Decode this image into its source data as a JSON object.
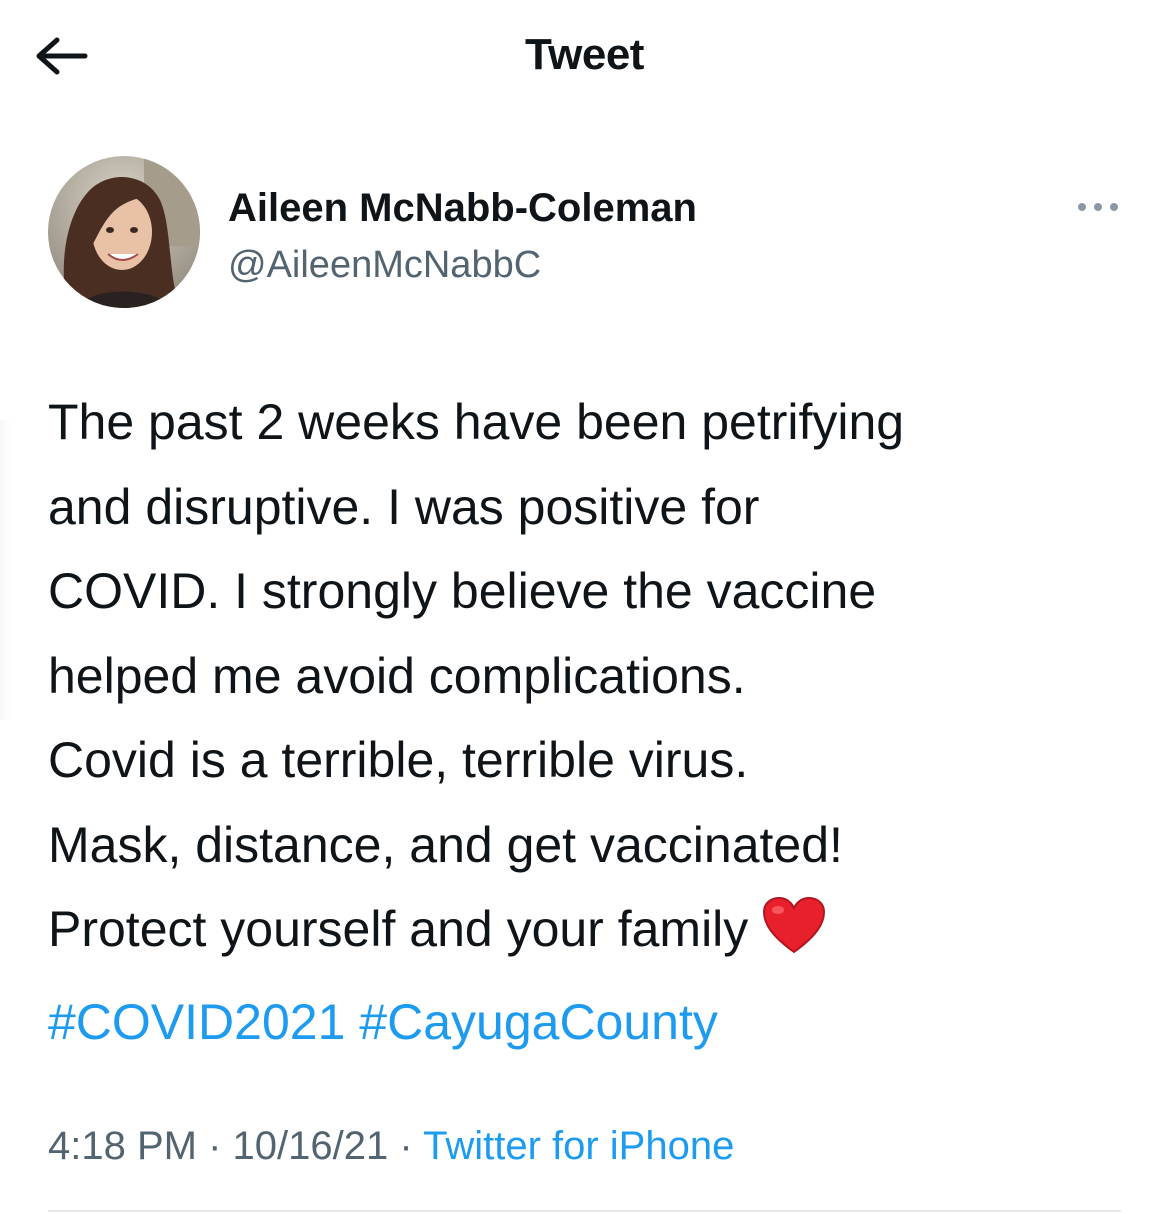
{
  "header": {
    "title": "Tweet",
    "back_icon": "arrow-left-icon"
  },
  "author": {
    "name": "Aileen McNabb-Coleman",
    "handle": "@AileenMcNabbC",
    "more_icon": "more-horizontal-icon"
  },
  "tweet": {
    "lines": [
      "The past 2 weeks have been petrifying",
      "and disruptive. I was positive for",
      "COVID. I strongly believe the vaccine",
      "helped me avoid complications.",
      "Covid is a terrible, terrible virus.",
      "Mask, distance, and get vaccinated!",
      "Protect yourself and your family"
    ],
    "emoji": "red-heart-icon",
    "hashtags": [
      "#COVID2021",
      "#CayugaCounty"
    ]
  },
  "meta": {
    "time": "4:18 PM",
    "separator": "·",
    "date": "10/16/21",
    "source": "Twitter for iPhone"
  },
  "colors": {
    "text": "#0f1419",
    "secondary": "#536471",
    "link": "#1d9bf0"
  }
}
